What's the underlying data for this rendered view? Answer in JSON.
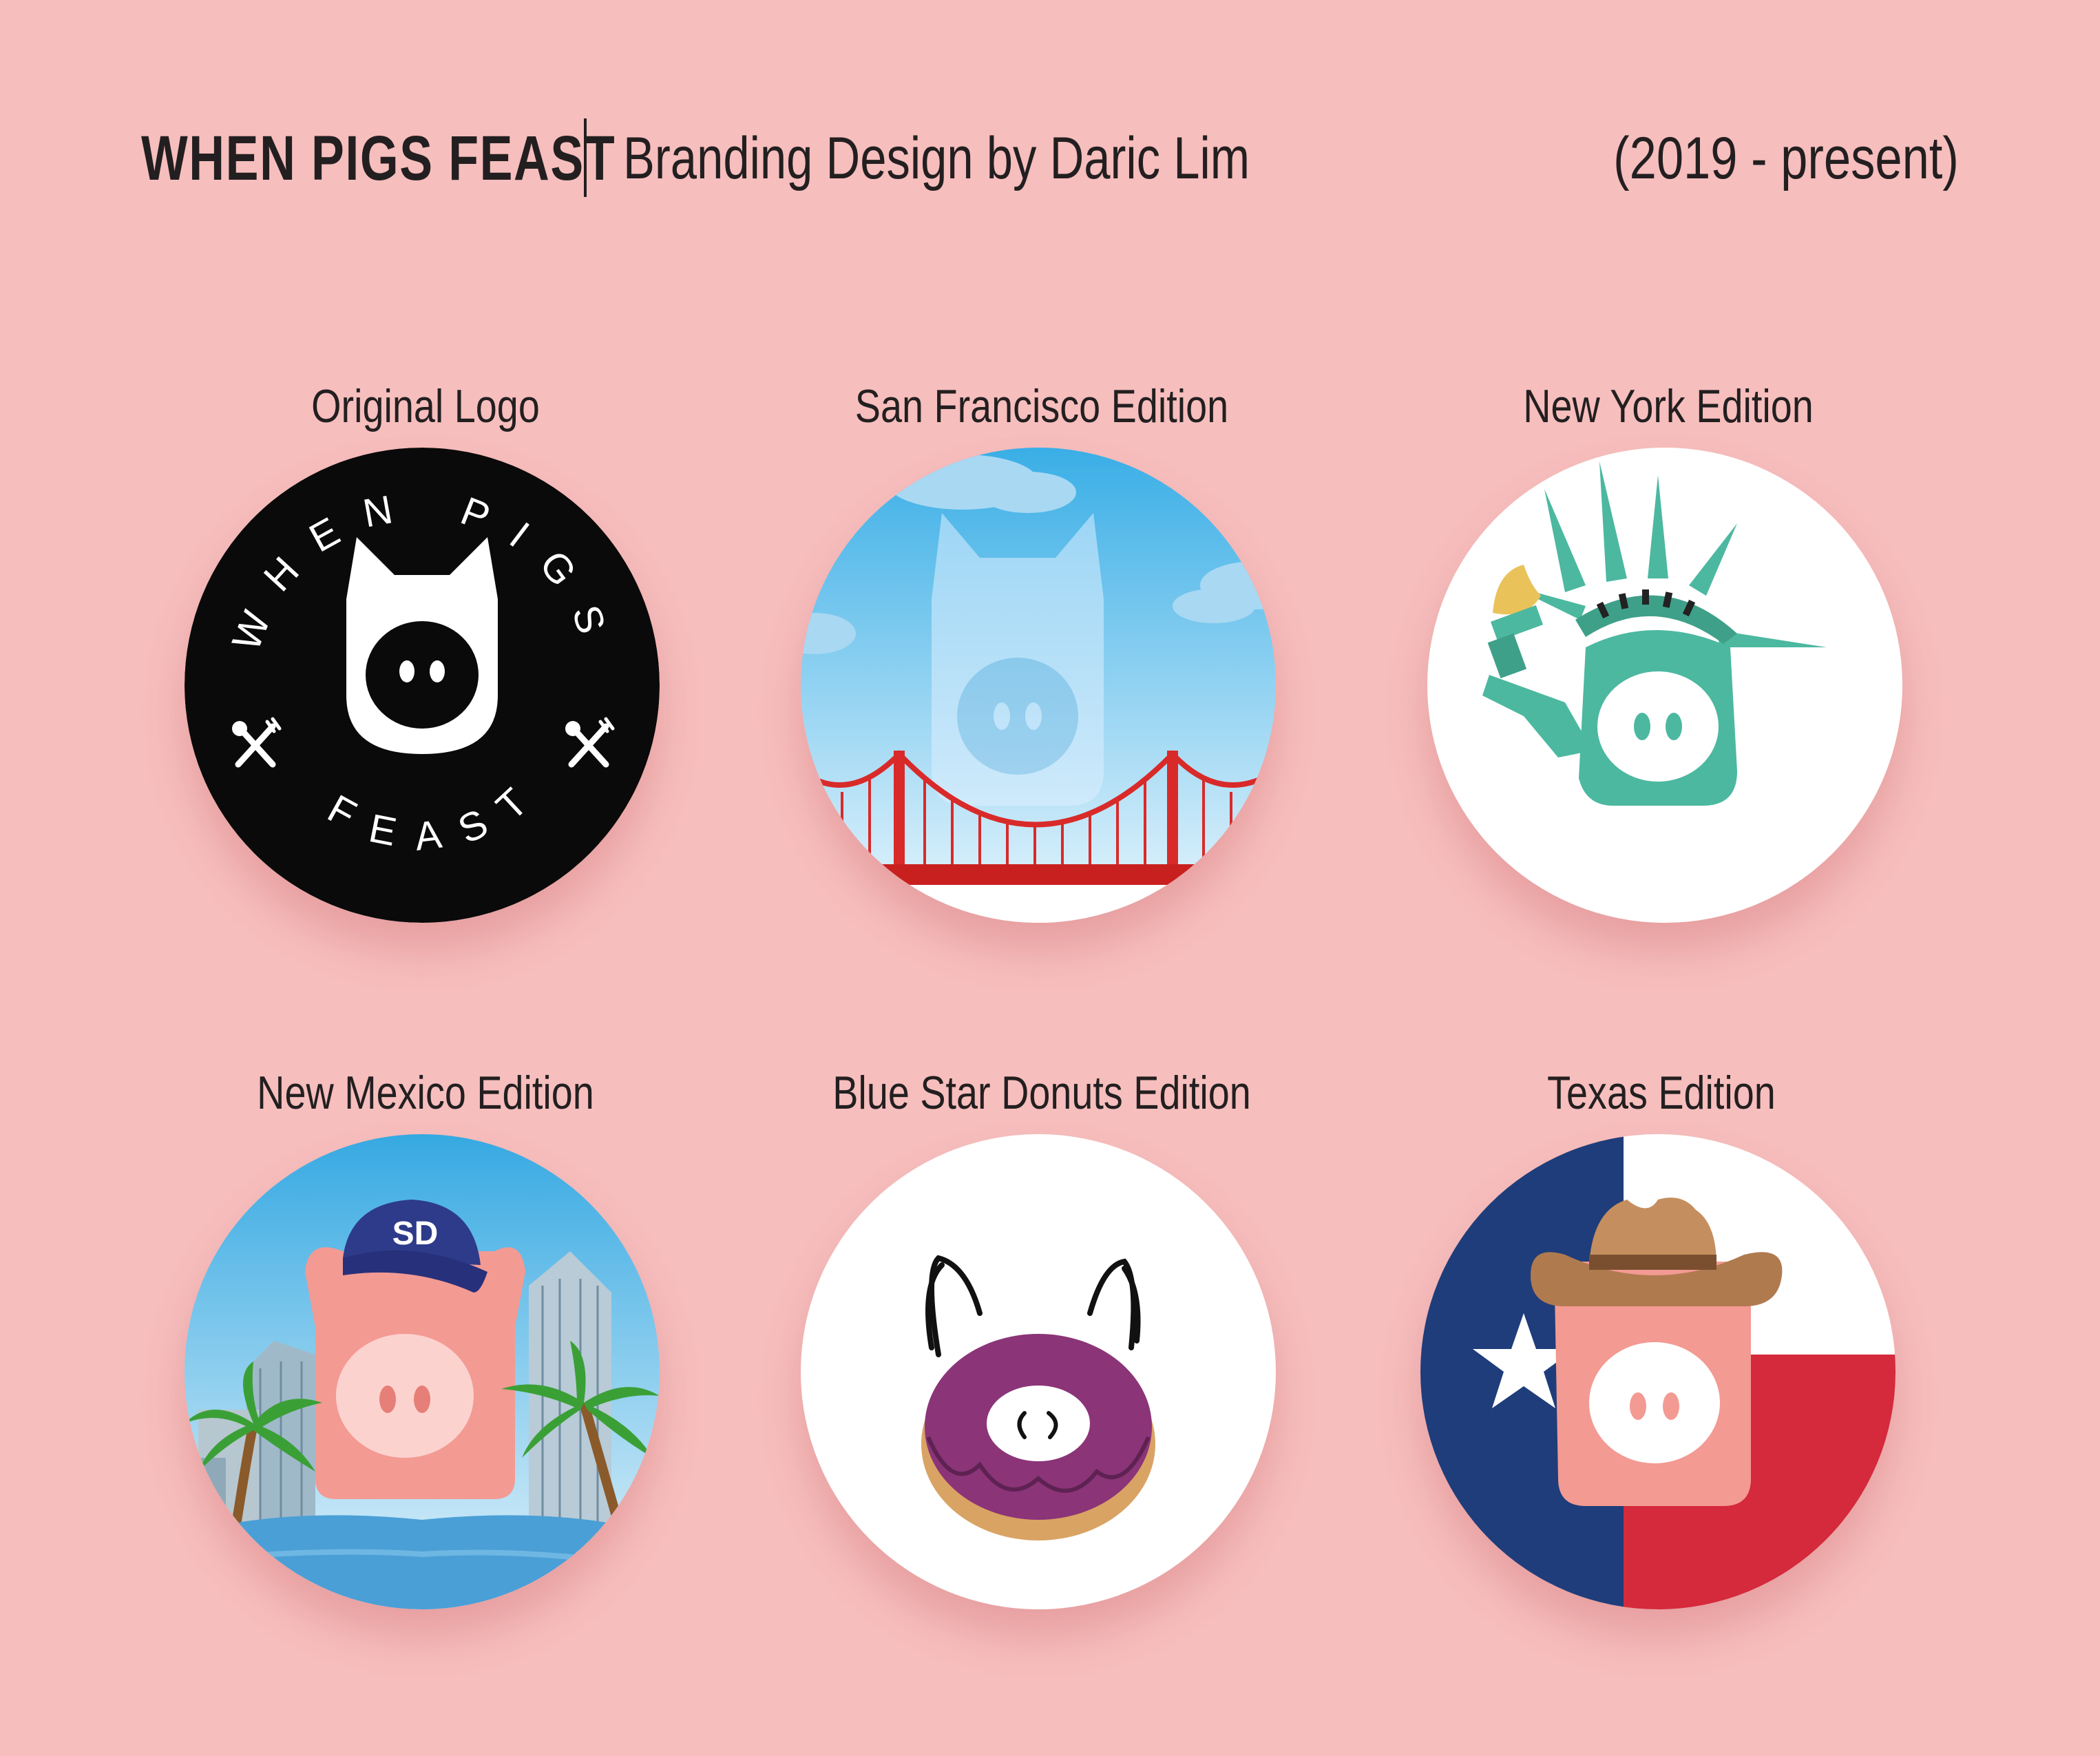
{
  "header": {
    "brand": "WHEN PIGS FEAST",
    "subtitle": "Branding Design by Daric Lim",
    "years": "(2019 - present)"
  },
  "cards": [
    {
      "label": "Original Logo",
      "ring_top": "WHEN PIGS",
      "ring_bottom": "FEAST"
    },
    {
      "label": "San Francisco Edition"
    },
    {
      "label": "New York Edition"
    },
    {
      "label": "New Mexico Edition",
      "cap_mark": "SD"
    },
    {
      "label": "Blue Star Donuts Edition"
    },
    {
      "label": "Texas Edition"
    }
  ],
  "colors": {
    "background": "#f6bebd",
    "pig_pink": "#f39a93",
    "liberty_green": "#4cb8a0",
    "bridge_red": "#e0282a",
    "texas_blue": "#1f3d7a",
    "texas_red": "#d42a3c",
    "donut_purple": "#8b3478"
  },
  "icons": [
    "spoon-fork-icon",
    "pig-face-icon",
    "statue-crown-icon",
    "torch-icon",
    "star-icon",
    "cowboy-hat-icon",
    "baseball-cap-icon",
    "palm-tree-icon",
    "golden-gate-bridge-icon",
    "donut-icon"
  ]
}
